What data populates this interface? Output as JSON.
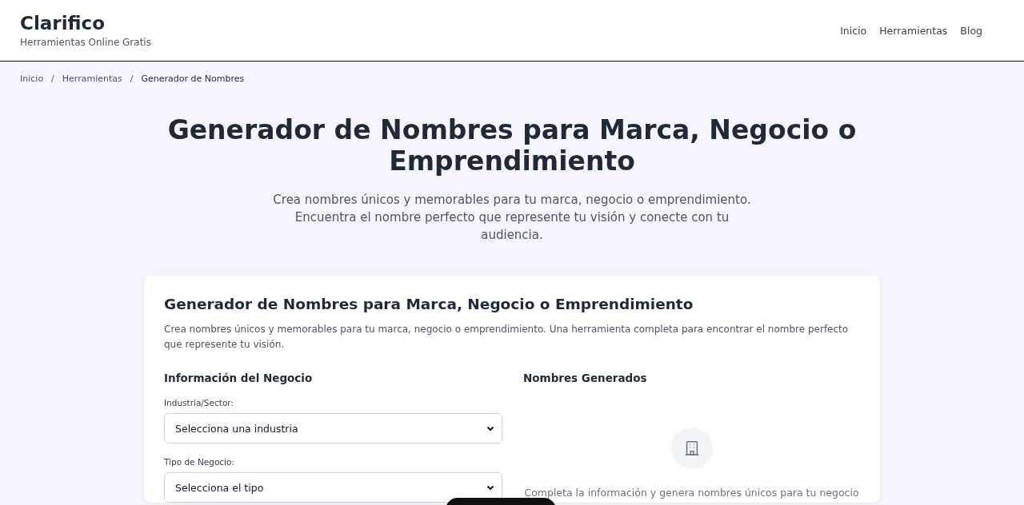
{
  "header": {
    "logo": "Clarifico",
    "tagline": "Herramientas Online Gratis"
  },
  "nav": [
    {
      "label": "Inicio"
    },
    {
      "label": "Herramientas"
    },
    {
      "label": "Blog"
    }
  ],
  "breadcrumb": [
    {
      "label": "Inicio",
      "current": false
    },
    {
      "label": "Herramientas",
      "current": false
    },
    {
      "label": "Generador de Nombres",
      "current": true
    }
  ],
  "breadcrumb_separator": "/",
  "hero": {
    "title": "Generador de Nombres para Marca, Negocio o Emprendimiento",
    "subtitle": "Crea nombres únicos y memorables para tu marca, negocio o emprendimiento. Encuentra el nombre perfecto que represente tu visión y conecte con tu audiencia."
  },
  "card": {
    "title": "Generador de Nombres para Marca, Negocio o Emprendimiento",
    "description": "Crea nombres únicos y memorables para tu marca, negocio o emprendimiento. Una herramienta completa para encontrar el nombre perfecto que represente tu visión.",
    "form": {
      "heading": "Información del Negocio",
      "fields": [
        {
          "label": "Industria/Sector:",
          "value": "Selecciona una industria"
        },
        {
          "label": "Tipo de Negocio:",
          "value": "Selecciona el tipo"
        }
      ]
    },
    "results": {
      "heading": "Nombres Generados",
      "empty_message": "Completa la información y genera nombres únicos para tu negocio"
    }
  }
}
